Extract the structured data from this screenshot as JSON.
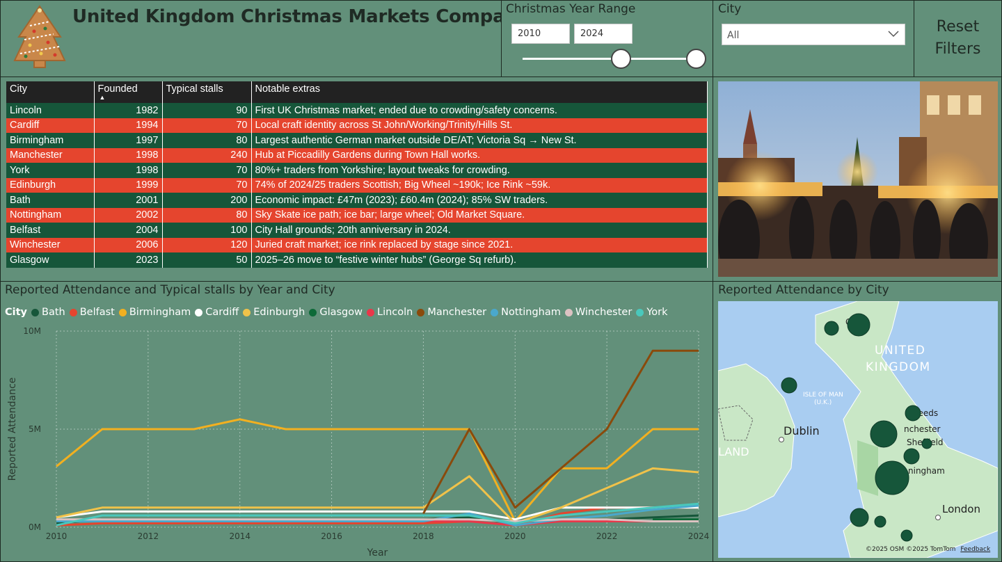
{
  "header": {
    "title": "United Kingdom Christmas Markets Comparison",
    "logo_icon": "gingerbread-christmas-tree-icon"
  },
  "year_slicer": {
    "title": "Christmas Year Range",
    "start": "2010",
    "end": "2024"
  },
  "city_slicer": {
    "title": "City",
    "selected": "All"
  },
  "reset": {
    "line1": "Reset",
    "line2": "Filters"
  },
  "table": {
    "columns": [
      "City",
      "Founded",
      "Typical stalls",
      "Notable extras"
    ],
    "sort_indicator": "▲",
    "rows": [
      {
        "city": "Lincoln",
        "founded": "1982",
        "stalls": "90",
        "extras": "First UK Christmas market; ended due to crowding/safety concerns.",
        "tone": "green"
      },
      {
        "city": "Cardiff",
        "founded": "1994",
        "stalls": "70",
        "extras": "Local craft identity across St John/Working/Trinity/Hills St.",
        "tone": "red"
      },
      {
        "city": "Birmingham",
        "founded": "1997",
        "stalls": "80",
        "extras": "Largest authentic German market outside DE/AT; Victoria Sq → New St.",
        "tone": "green"
      },
      {
        "city": "Manchester",
        "founded": "1998",
        "stalls": "240",
        "extras": "Hub at Piccadilly Gardens during Town Hall works.",
        "tone": "red"
      },
      {
        "city": "York",
        "founded": "1998",
        "stalls": "70",
        "extras": "80%+ traders from Yorkshire; layout tweaks for crowding.",
        "tone": "green"
      },
      {
        "city": "Edinburgh",
        "founded": "1999",
        "stalls": "70",
        "extras": "74% of 2024/25 traders Scottish; Big Wheel ~190k; Ice Rink ~59k.",
        "tone": "red"
      },
      {
        "city": "Bath",
        "founded": "2001",
        "stalls": "200",
        "extras": "Economic impact: £47m (2023); £60.4m (2024); 85% SW traders.",
        "tone": "green"
      },
      {
        "city": "Nottingham",
        "founded": "2002",
        "stalls": "80",
        "extras": "Sky Skate ice path; ice bar; large wheel; Old Market Square.",
        "tone": "red"
      },
      {
        "city": "Belfast",
        "founded": "2004",
        "stalls": "100",
        "extras": "City Hall grounds; 20th anniversary in 2024.",
        "tone": "green"
      },
      {
        "city": "Winchester",
        "founded": "2006",
        "stalls": "120",
        "extras": "Juried craft market; ice rink replaced by stage since 2021.",
        "tone": "red"
      },
      {
        "city": "Glasgow",
        "founded": "2023",
        "stalls": "50",
        "extras": "2025–26 move to “festive winter hubs” (George Sq refurb).",
        "tone": "green"
      }
    ],
    "colors": {
      "green": "#16563a",
      "red": "#e5452e",
      "header": "#222222"
    }
  },
  "photo": {
    "icon": "christmas-market-photo"
  },
  "line_chart": {
    "title": "Reported Attendance and Typical stalls by Year and City",
    "legend_title": "City"
  },
  "chart_data": {
    "type": "line",
    "title": "Reported Attendance and Typical stalls by Year and City",
    "xlabel": "Year",
    "ylabel": "Reported Attendance",
    "x": [
      2010,
      2011,
      2012,
      2013,
      2014,
      2015,
      2016,
      2017,
      2018,
      2019,
      2020,
      2021,
      2022,
      2023,
      2024
    ],
    "xlim": [
      2010,
      2024
    ],
    "ylim": [
      0,
      10000000
    ],
    "x_ticks": [
      "2010",
      "2012",
      "2014",
      "2016",
      "2018",
      "2020",
      "2022",
      "2024"
    ],
    "y_ticks": [
      {
        "value": 0,
        "label": "0M"
      },
      {
        "value": 5000000,
        "label": "5M"
      },
      {
        "value": 10000000,
        "label": "10M"
      }
    ],
    "grid": true,
    "legend_position": "top-left",
    "series": [
      {
        "name": "Bath",
        "color": "#16563a",
        "values": [
          200000,
          400000,
          400000,
          400000,
          400000,
          400000,
          400000,
          400000,
          400000,
          500000,
          200000,
          400000,
          400000,
          500000,
          600000
        ]
      },
      {
        "name": "Belfast",
        "color": "#e5452e",
        "values": [
          100000,
          200000,
          200000,
          200000,
          200000,
          200000,
          200000,
          200000,
          200000,
          300000,
          100000,
          700000,
          1000000,
          1000000,
          1000000
        ]
      },
      {
        "name": "Birmingham",
        "color": "#f2b020",
        "values": [
          3100000,
          5000000,
          5000000,
          5000000,
          5500000,
          5000000,
          5000000,
          5000000,
          5000000,
          5000000,
          300000,
          3000000,
          3000000,
          5000000,
          5000000
        ]
      },
      {
        "name": "Cardiff",
        "color": "#ffffff",
        "values": [
          500000,
          800000,
          800000,
          800000,
          800000,
          800000,
          800000,
          800000,
          800000,
          800000,
          400000,
          1000000,
          1000000,
          1000000,
          1000000
        ]
      },
      {
        "name": "Edinburgh",
        "color": "#f0c24a",
        "values": [
          500000,
          1000000,
          1000000,
          1000000,
          1000000,
          1000000,
          1000000,
          1000000,
          1000000,
          2600000,
          200000,
          1000000,
          2000000,
          3000000,
          2800000
        ]
      },
      {
        "name": "Glasgow",
        "color": "#0d6a38",
        "values": [
          null,
          null,
          null,
          null,
          null,
          null,
          null,
          null,
          null,
          null,
          null,
          null,
          null,
          400000,
          400000
        ]
      },
      {
        "name": "Lincoln",
        "color": "#e8384a",
        "values": [
          300000,
          300000,
          300000,
          300000,
          300000,
          300000,
          300000,
          300000,
          300000,
          300000,
          100000,
          300000,
          300000,
          300000,
          300000
        ]
      },
      {
        "name": "Manchester",
        "color": "#8a4a0b",
        "values": [
          null,
          null,
          null,
          null,
          null,
          null,
          null,
          null,
          700000,
          5000000,
          1000000,
          3000000,
          5000000,
          9000000,
          9000000
        ]
      },
      {
        "name": "Nottingham",
        "color": "#4aa8cc",
        "values": [
          300000,
          300000,
          300000,
          300000,
          300000,
          300000,
          300000,
          300000,
          300000,
          700000,
          100000,
          400000,
          600000,
          900000,
          1100000
        ]
      },
      {
        "name": "Winchester",
        "color": "#dcc2c2",
        "values": [
          400000,
          400000,
          400000,
          400000,
          400000,
          400000,
          400000,
          400000,
          400000,
          400000,
          300000,
          400000,
          400000,
          300000,
          300000
        ]
      },
      {
        "name": "York",
        "color": "#4ac8bc",
        "values": [
          100000,
          600000,
          600000,
          600000,
          600000,
          600000,
          600000,
          600000,
          600000,
          600000,
          200000,
          600000,
          800000,
          1000000,
          1200000
        ]
      }
    ]
  },
  "map": {
    "title": "Reported Attendance by City",
    "labels": {
      "country_line1": "UNITED",
      "country_line2": "KINGDOM",
      "isle_line1": "ISLE OF MAN",
      "isle_line2": "(U.K.)",
      "dublin": "Dublin",
      "ireland_fragment": "LAND",
      "glasgow_fragment": "Gla",
      "leeds_fragment": "Leeds",
      "manchester_fragment": "nchester",
      "sheffield": "Sheffield",
      "birmingham_fragment": "ningham",
      "london": "London"
    },
    "credit": "©2025 OSM  ©2025 TomTom",
    "feedback": "Feedback",
    "bubble_color": "#16563a"
  }
}
